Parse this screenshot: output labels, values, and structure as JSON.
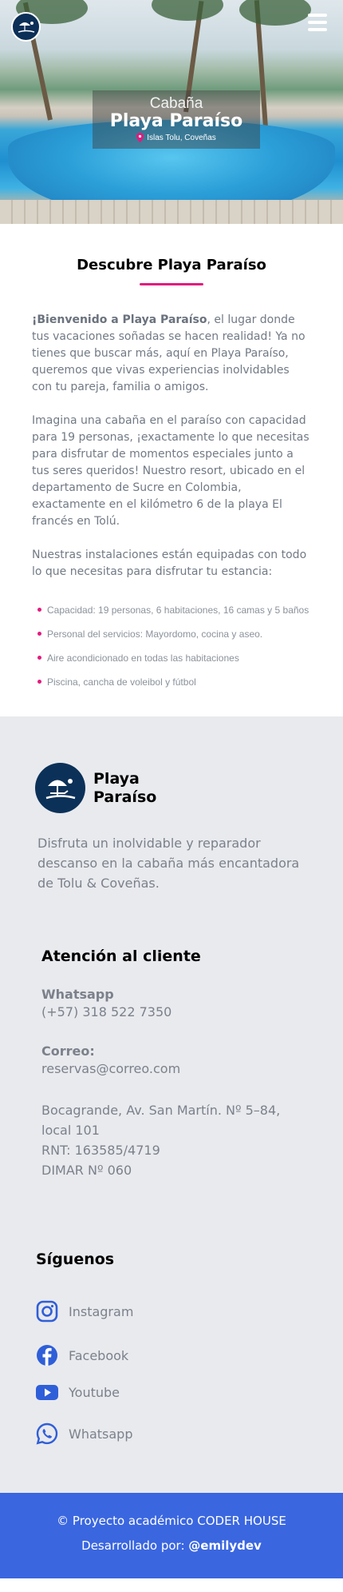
{
  "hero": {
    "subtitle": "Cabaña",
    "title": "Playa Paraíso",
    "location": "Islas Tolu, Coveñas"
  },
  "about": {
    "heading": "Descubre Playa Paraíso",
    "intro_bold": "¡Bienvenido a Playa Paraíso",
    "intro_rest": ", el lugar donde tus vacaciones soñadas se hacen realidad! Ya no tienes que buscar más, aquí en Playa Paraíso, queremos que vivas experiencias inolvidables con tu pareja, familia o amigos.",
    "p2": "Imagina una cabaña en el paraíso con capacidad para 19 personas, ¡exactamente lo que necesitas para disfrutar de momentos especiales junto a tus seres queridos! Nuestro resort, ubicado en el departamento de Sucre en Colombia, exactamente en el kilómetro 6 de la playa El francés en Tolú.",
    "p3": "Nuestras instalaciones están equipadas con todo lo que necesitas para disfrutar tu estancia:",
    "features": [
      "Capacidad: 19 personas, 6 habitaciones, 16 camas y 5 baños",
      "Personal del servicios: Mayordomo, cocina y aseo.",
      "Aire acondicionado en todas las habitaciones",
      "Piscina, cancha de voleibol y fútbol"
    ]
  },
  "brand": {
    "name": "Playa Paraíso",
    "description": "Disfruta un inolvidable y reparador descanso en la cabaña más encantadora de Tolu & Coveñas."
  },
  "contact": {
    "heading": "Atención al cliente",
    "whatsapp_label": "Whatsapp",
    "whatsapp_value": "(+57) 318 522 7350",
    "email_label": "Correo:",
    "email_value": "reservas@correo.com",
    "address": "Bocagrande, Av. San Martín. Nº 5–84, local 101",
    "rnt": "RNT: 163585/4719",
    "dimar": "DIMAR Nº 060"
  },
  "follow": {
    "heading": "Síguenos",
    "links": [
      {
        "label": "Instagram",
        "icon": "instagram-icon"
      },
      {
        "label": "Facebook",
        "icon": "facebook-icon"
      },
      {
        "label": "Youtube",
        "icon": "youtube-icon"
      },
      {
        "label": "Whatsapp",
        "icon": "whatsapp-icon"
      }
    ]
  },
  "footer": {
    "line1": "© Proyecto académico CODER HOUSE",
    "line2_prefix": "Desarrollado por: ",
    "line2_author": "@emilydev"
  },
  "colors": {
    "accent": "#e4197e",
    "brand_navy": "#0c3158",
    "footer_blue": "#3a66e0",
    "social_blue": "#2f5fd8"
  }
}
